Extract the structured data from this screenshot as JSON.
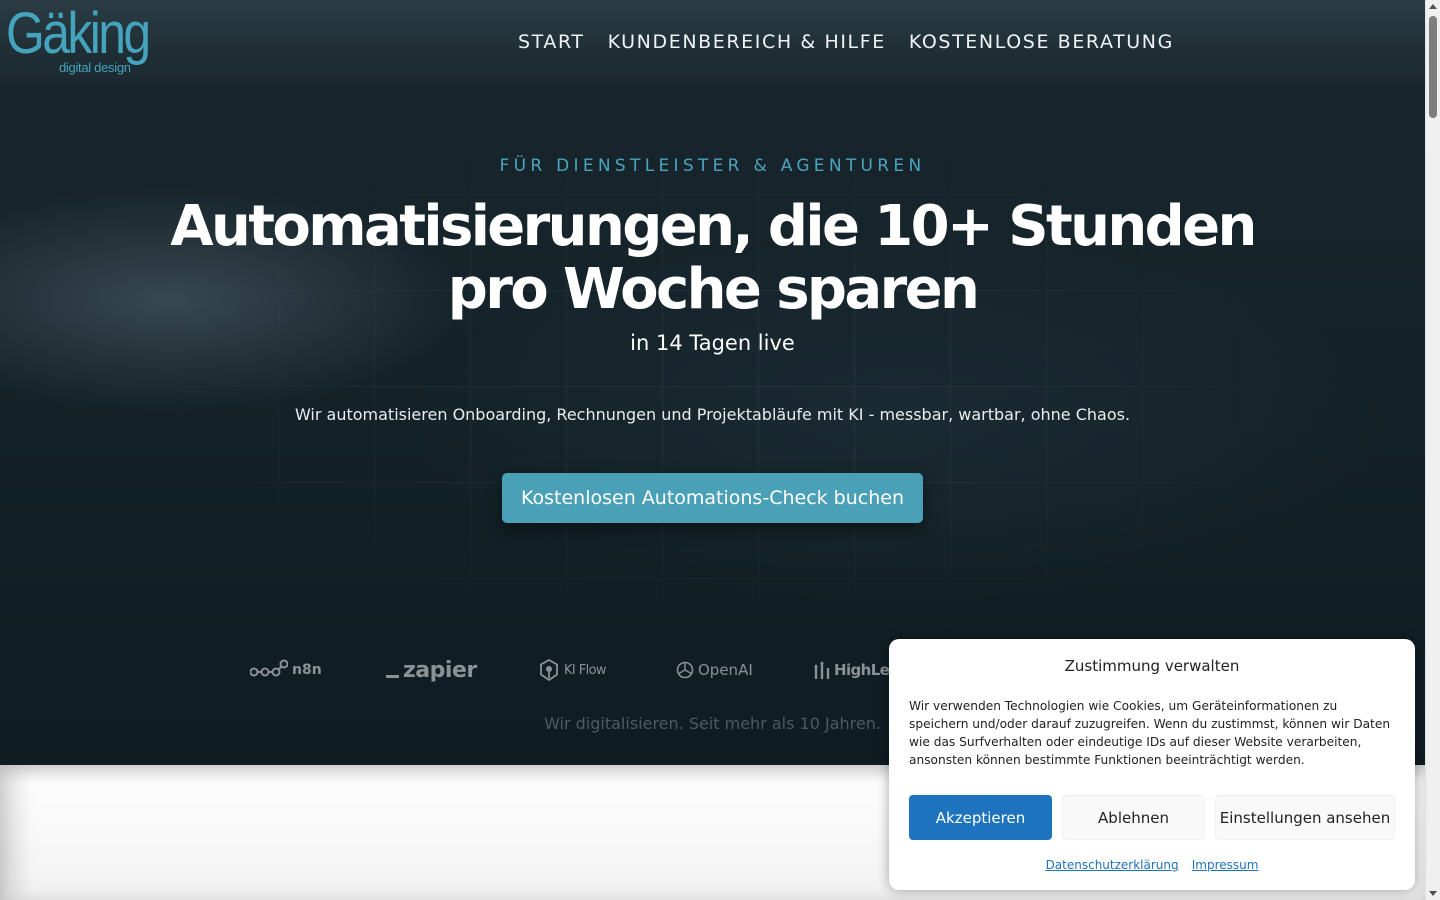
{
  "brand": {
    "logo_main": "Gäking",
    "logo_sub": "digital design",
    "color": "#45a4bd"
  },
  "nav": {
    "items": [
      {
        "label": "START"
      },
      {
        "label": "KUNDENBEREICH & HILFE"
      },
      {
        "label": "KOSTENLOSE BERATUNG"
      }
    ]
  },
  "hero": {
    "eyebrow": "FÜR DIENSTLEISTER & AGENTUREN",
    "headline": "Automatisierungen, die 10+ Stunden pro Woche sparen",
    "subline": "in 14 Tagen live",
    "lead": "Wir automatisieren Onboarding, Rechnungen und Projektabläufe mit KI - messbar, wartbar, ohne Chaos.",
    "cta_label": "Kostenlosen Automations-Check buchen",
    "cta_color": "#4aa0b6"
  },
  "partners": {
    "logos": [
      {
        "name": "n8n",
        "icon": "n8n-icon"
      },
      {
        "name": "zapier",
        "icon": "zapier-logo"
      },
      {
        "name": "KI Flow",
        "icon": "kiflow-icon"
      },
      {
        "name": "OpenAI",
        "icon": "openai-icon"
      },
      {
        "name": "HighLevel",
        "icon": "highlevel-icon"
      }
    ],
    "tagline": "Wir digitalisieren. Seit mehr als 10 Jahren."
  },
  "consent": {
    "title": "Zustimmung verwalten",
    "text": "Wir verwenden Technologien wie Cookies, um Geräteinformationen zu speichern und/oder darauf zuzugreifen. Wenn du zustimmst, können wir Daten wie das Surfverhalten oder eindeutige IDs auf dieser Website verarbeiten, ansonsten können bestimmte Funktionen beeinträchtigt werden.",
    "accept_label": "Akzeptieren",
    "deny_label": "Ablehnen",
    "prefs_label": "Einstellungen ansehen",
    "privacy_link": "Datenschutzerklärung",
    "imprint_link": "Impressum",
    "accent_color": "#1e73be"
  }
}
